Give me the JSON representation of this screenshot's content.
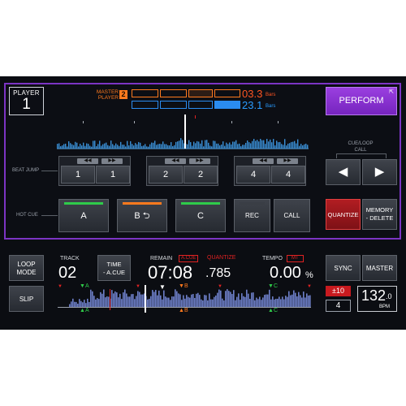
{
  "player": {
    "label": "PLAYER",
    "number": "1"
  },
  "master": {
    "label_line1": "MASTER",
    "label_line2": "PLAYER",
    "player_num": "2"
  },
  "bars": {
    "top_value": "03.3",
    "top_unit": "Bars",
    "bottom_value": "23.1",
    "bottom_unit": "Bars"
  },
  "perform": {
    "label": "PERFORM"
  },
  "beat_jump": {
    "label": "BEAT JUMP",
    "groups": [
      {
        "left": "1",
        "right": "1",
        "hdr_left": "◀◀",
        "hdr_right": "▶▶"
      },
      {
        "left": "2",
        "right": "2",
        "hdr_left": "◀◀",
        "hdr_right": "▶▶"
      },
      {
        "left": "4",
        "right": "4",
        "hdr_left": "◀◀",
        "hdr_right": "▶▶"
      }
    ]
  },
  "cue_loop": {
    "label": "CUE/LOOP",
    "call": "CALL",
    "prev": "◀",
    "next": "▶"
  },
  "hot_cue": {
    "label": "HOT CUE",
    "pads": [
      {
        "label": "A",
        "color": "#2fcb4a"
      },
      {
        "label": "B ⮌",
        "color": "#ff7a1e"
      },
      {
        "label": "C",
        "color": "#2fcb4a"
      }
    ],
    "rec": "REC",
    "call": "CALL"
  },
  "quantize_btn": {
    "label": "QUANTIZE"
  },
  "memory_btn": {
    "line1": "MEMORY",
    "line2": "- DELETE"
  },
  "loop_mode": {
    "line1": "LOOP",
    "line2": "MODE"
  },
  "slip": {
    "label": "SLIP"
  },
  "track": {
    "label": "TRACK",
    "value": "02"
  },
  "time_btn": {
    "line1": "TIME",
    "line2": "- A.CUE"
  },
  "remain": {
    "label": "REMAIN",
    "acue": "A.CUE",
    "quantize": "QUANTIZE",
    "main": "07:08",
    "decimals": ".785"
  },
  "tempo": {
    "label": "TEMPO",
    "mt": "MT",
    "value": "0.00",
    "unit": "%"
  },
  "sync": {
    "label": "SYNC"
  },
  "master_btn": {
    "label": "MASTER"
  },
  "tempo_range": {
    "label": "±10"
  },
  "bpm": {
    "value": "132",
    "decimal": ".0",
    "unit": "BPM"
  },
  "beat_counter": {
    "value": "4"
  },
  "wave_markers": {
    "a": "A",
    "b": "B",
    "c": "C"
  },
  "colors": {
    "accent": "#7c34c4",
    "orange": "#ff7a1e",
    "blue": "#2a8cf0",
    "red": "#e02222",
    "green": "#2fcb4a"
  }
}
